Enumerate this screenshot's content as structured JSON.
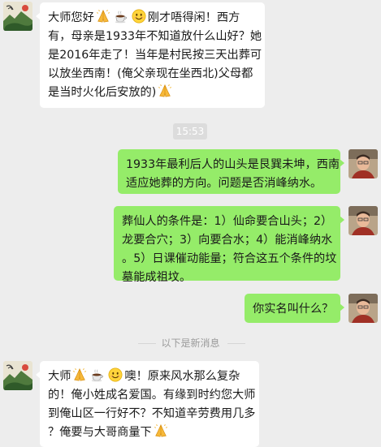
{
  "messages": [
    {
      "sender": "contact",
      "avatar_icon": "landscape-painting-avatar-icon",
      "lines": [
        [
          {
            "t": "大师您好"
          },
          {
            "e": "praying-hands-emoji"
          },
          {
            "e": "hot-coffee-emoji"
          },
          {
            "e": "smiling-face-emoji"
          },
          {
            "t": "刚才唔得闲！西方"
          }
        ],
        [
          {
            "t": "有，母亲是1933年不知道放什么山好？她"
          }
        ],
        [
          {
            "t": "是2016年走了！当年是村民按三天出葬可"
          }
        ],
        [
          {
            "t": "以放坐西南！(俺父亲现在坐西北)父母都"
          }
        ],
        [
          {
            "t": "是当时火化后安放的)"
          },
          {
            "e": "praying-hands-emoji"
          }
        ]
      ]
    },
    {
      "sender": "self",
      "avatar_icon": "man-portrait-avatar-icon",
      "lines": [
        [
          {
            "t": "1933年最利后人的山头是艮巽未坤，西南"
          }
        ],
        [
          {
            "t": "适应她葬的方向。问题是否消峰纳水。"
          }
        ]
      ]
    },
    {
      "sender": "self",
      "avatar_icon": "man-portrait-avatar-icon",
      "lines": [
        [
          {
            "t": "葬仙人的条件是：1）仙命要合山头；2）"
          }
        ],
        [
          {
            "t": "龙要合穴；3）向要合水；4）能消峰纳水"
          }
        ],
        [
          {
            "t": "。5）日课催动能量；符合这五个条件的坟"
          }
        ],
        [
          {
            "t": "墓能成祖坟。"
          }
        ]
      ]
    },
    {
      "sender": "self",
      "avatar_icon": "man-portrait-avatar-icon",
      "lines": [
        [
          {
            "t": "你实名叫什么？"
          }
        ]
      ]
    },
    {
      "sender": "contact",
      "avatar_icon": "landscape-painting-avatar-icon",
      "lines": [
        [
          {
            "t": "大师"
          },
          {
            "e": "praying-hands-emoji"
          },
          {
            "e": "hot-coffee-emoji"
          },
          {
            "e": "smiling-face-emoji"
          },
          {
            "t": "噢！原来风水那么复杂"
          }
        ],
        [
          {
            "t": "的！俺小姓成名爱国。有缘到时约您大师"
          }
        ],
        [
          {
            "t": "到俺山区一行好不？不知道辛劳费用几多"
          }
        ],
        [
          {
            "t": "？俺要与大哥商量下"
          },
          {
            "e": "praying-hands-emoji"
          }
        ]
      ]
    }
  ],
  "timestamp": "15:53",
  "new_messages_divider": "以下是新消息",
  "colors": {
    "background": "#ededed",
    "incoming_bubble": "#ffffff",
    "outgoing_bubble": "#95ec69",
    "timestamp_bg": "#dcdcdc",
    "divider_text": "#9a9a9a"
  }
}
